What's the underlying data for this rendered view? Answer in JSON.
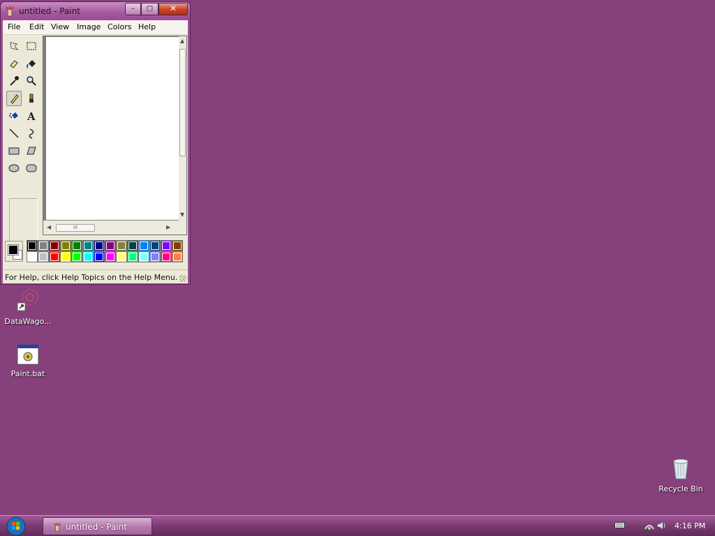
{
  "window": {
    "title": "untitled - Paint",
    "controls": {
      "minimize": "–",
      "maximize": "□",
      "close": "✕"
    }
  },
  "menu": [
    "File",
    "Edit",
    "View",
    "Image",
    "Colors",
    "Help"
  ],
  "tools": [
    "free-form-select",
    "select",
    "eraser",
    "fill-with-color",
    "pick-color",
    "magnifier",
    "pencil",
    "brush",
    "airbrush",
    "text",
    "line",
    "curve",
    "rectangle",
    "polygon",
    "ellipse",
    "rounded-rectangle"
  ],
  "selected_tool": "pencil",
  "scrollbar": {
    "thumb_grip": "III"
  },
  "colors": {
    "foreground": "#000000",
    "background": "#ffffff",
    "palette_top": [
      "#000000",
      "#808080",
      "#800000",
      "#808000",
      "#008000",
      "#008080",
      "#000080",
      "#800080",
      "#808040",
      "#004040",
      "#0080ff",
      "#004080",
      "#8000ff",
      "#804000"
    ],
    "palette_bottom": [
      "#ffffff",
      "#c0c0c0",
      "#ff0000",
      "#ffff00",
      "#00ff00",
      "#00ffff",
      "#0000ff",
      "#ff00ff",
      "#ffff80",
      "#00ff80",
      "#80ffff",
      "#8080ff",
      "#ff0080",
      "#ff8040"
    ]
  },
  "status": "For Help, click Help Topics on the Help Menu.",
  "desktop": {
    "icons": [
      {
        "label": "DataWago..."
      },
      {
        "label": "Paint.bat"
      },
      {
        "label": "Recycle Bin"
      }
    ]
  },
  "taskbar": {
    "task_label": "untitled - Paint",
    "clock": "4:16 PM"
  }
}
